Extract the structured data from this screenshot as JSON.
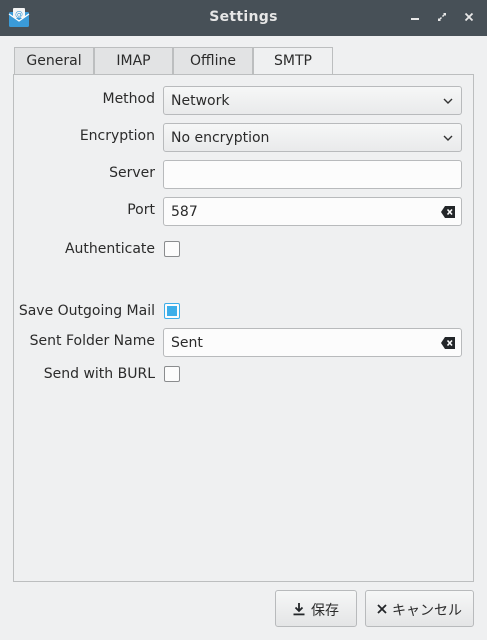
{
  "window": {
    "title": "Settings",
    "app_icon": "mail-icon"
  },
  "tabs": [
    {
      "label": "General"
    },
    {
      "label": "IMAP"
    },
    {
      "label": "Offline"
    },
    {
      "label": "SMTP",
      "active": true
    }
  ],
  "form": {
    "method": {
      "label": "Method",
      "value": "Network"
    },
    "encryption": {
      "label": "Encryption",
      "value": "No encryption"
    },
    "server": {
      "label": "Server",
      "value": ""
    },
    "port": {
      "label": "Port",
      "value": "587"
    },
    "authenticate": {
      "label": "Authenticate",
      "checked": false
    },
    "save_outgoing": {
      "label": "Save Outgoing Mail",
      "checked": true
    },
    "sent_folder": {
      "label": "Sent Folder Name",
      "value": "Sent"
    },
    "send_burl": {
      "label": "Send with BURL",
      "checked": false
    }
  },
  "buttons": {
    "save": {
      "label": "保存",
      "icon": "download-icon"
    },
    "cancel": {
      "label": "キャンセル",
      "icon": "close-icon"
    }
  },
  "colors": {
    "titlebar": "#475057",
    "accent": "#3daee9",
    "background": "#eff0f1"
  }
}
